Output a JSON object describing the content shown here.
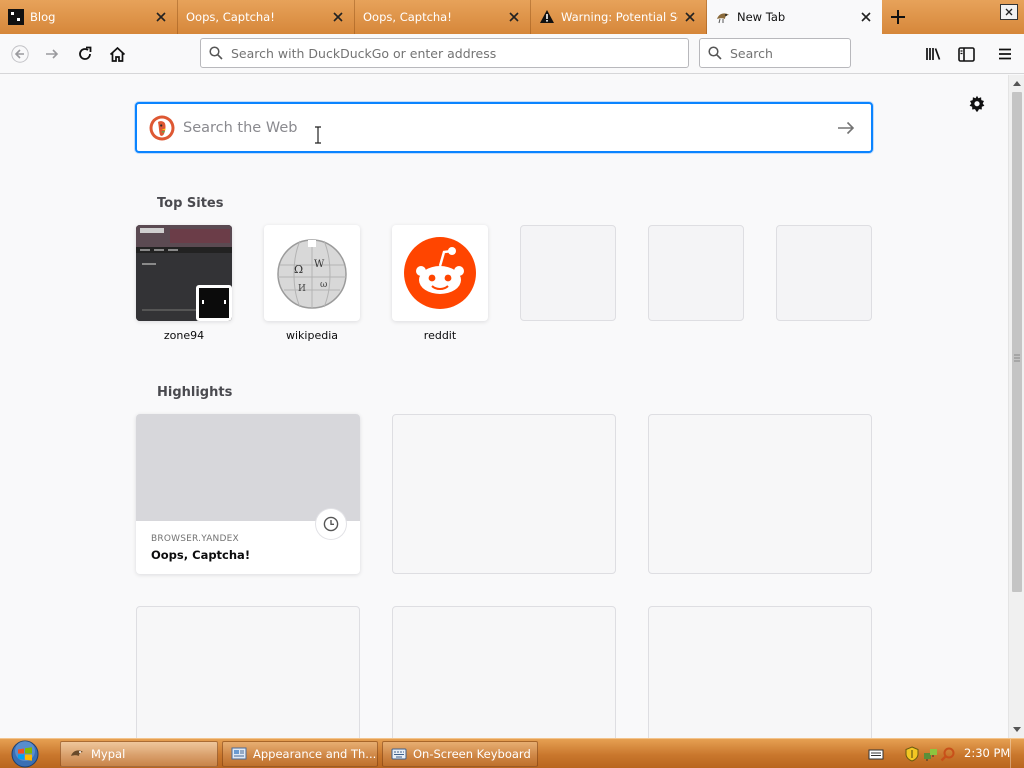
{
  "browser": {
    "tabs": [
      {
        "label": "Blog",
        "icon": "blog-favicon",
        "active": false
      },
      {
        "label": "Oops, Captcha!",
        "icon": "none",
        "active": false
      },
      {
        "label": "Oops, Captcha!",
        "icon": "none",
        "active": false
      },
      {
        "label": "Warning: Potential Se",
        "icon": "warning-icon",
        "active": false
      },
      {
        "label": "New Tab",
        "icon": "mypal-favicon",
        "active": true
      }
    ],
    "url_placeholder": "Search with DuckDuckGo or enter address",
    "search_placeholder": "Search"
  },
  "newtab": {
    "search_placeholder": "Search the Web",
    "top_sites_title": "Top Sites",
    "top_sites": [
      {
        "label": "zone94",
        "thumb": "zone94-screenshot"
      },
      {
        "label": "wikipedia",
        "thumb": "wikipedia-globe"
      },
      {
        "label": "reddit",
        "thumb": "reddit-logo"
      },
      {
        "label": "",
        "thumb": "empty"
      },
      {
        "label": "",
        "thumb": "empty"
      },
      {
        "label": "",
        "thumb": "empty"
      }
    ],
    "highlights_title": "Highlights",
    "highlights": [
      {
        "host": "BROWSER.YANDEX",
        "title": "Oops, Captcha!",
        "icon": "clock-icon"
      }
    ]
  },
  "taskbar": {
    "buttons": [
      {
        "label": "Mypal",
        "active": true
      },
      {
        "label": "Appearance and Th...",
        "active": false
      },
      {
        "label": "On-Screen Keyboard",
        "active": false
      }
    ],
    "clock": "2:30 PM"
  },
  "colors": {
    "accent": "#0a84ff",
    "taskbar": "#c9772d",
    "tabstrip": "#d6873a",
    "reddit": "#ff4500",
    "ddg": "#de5833"
  }
}
